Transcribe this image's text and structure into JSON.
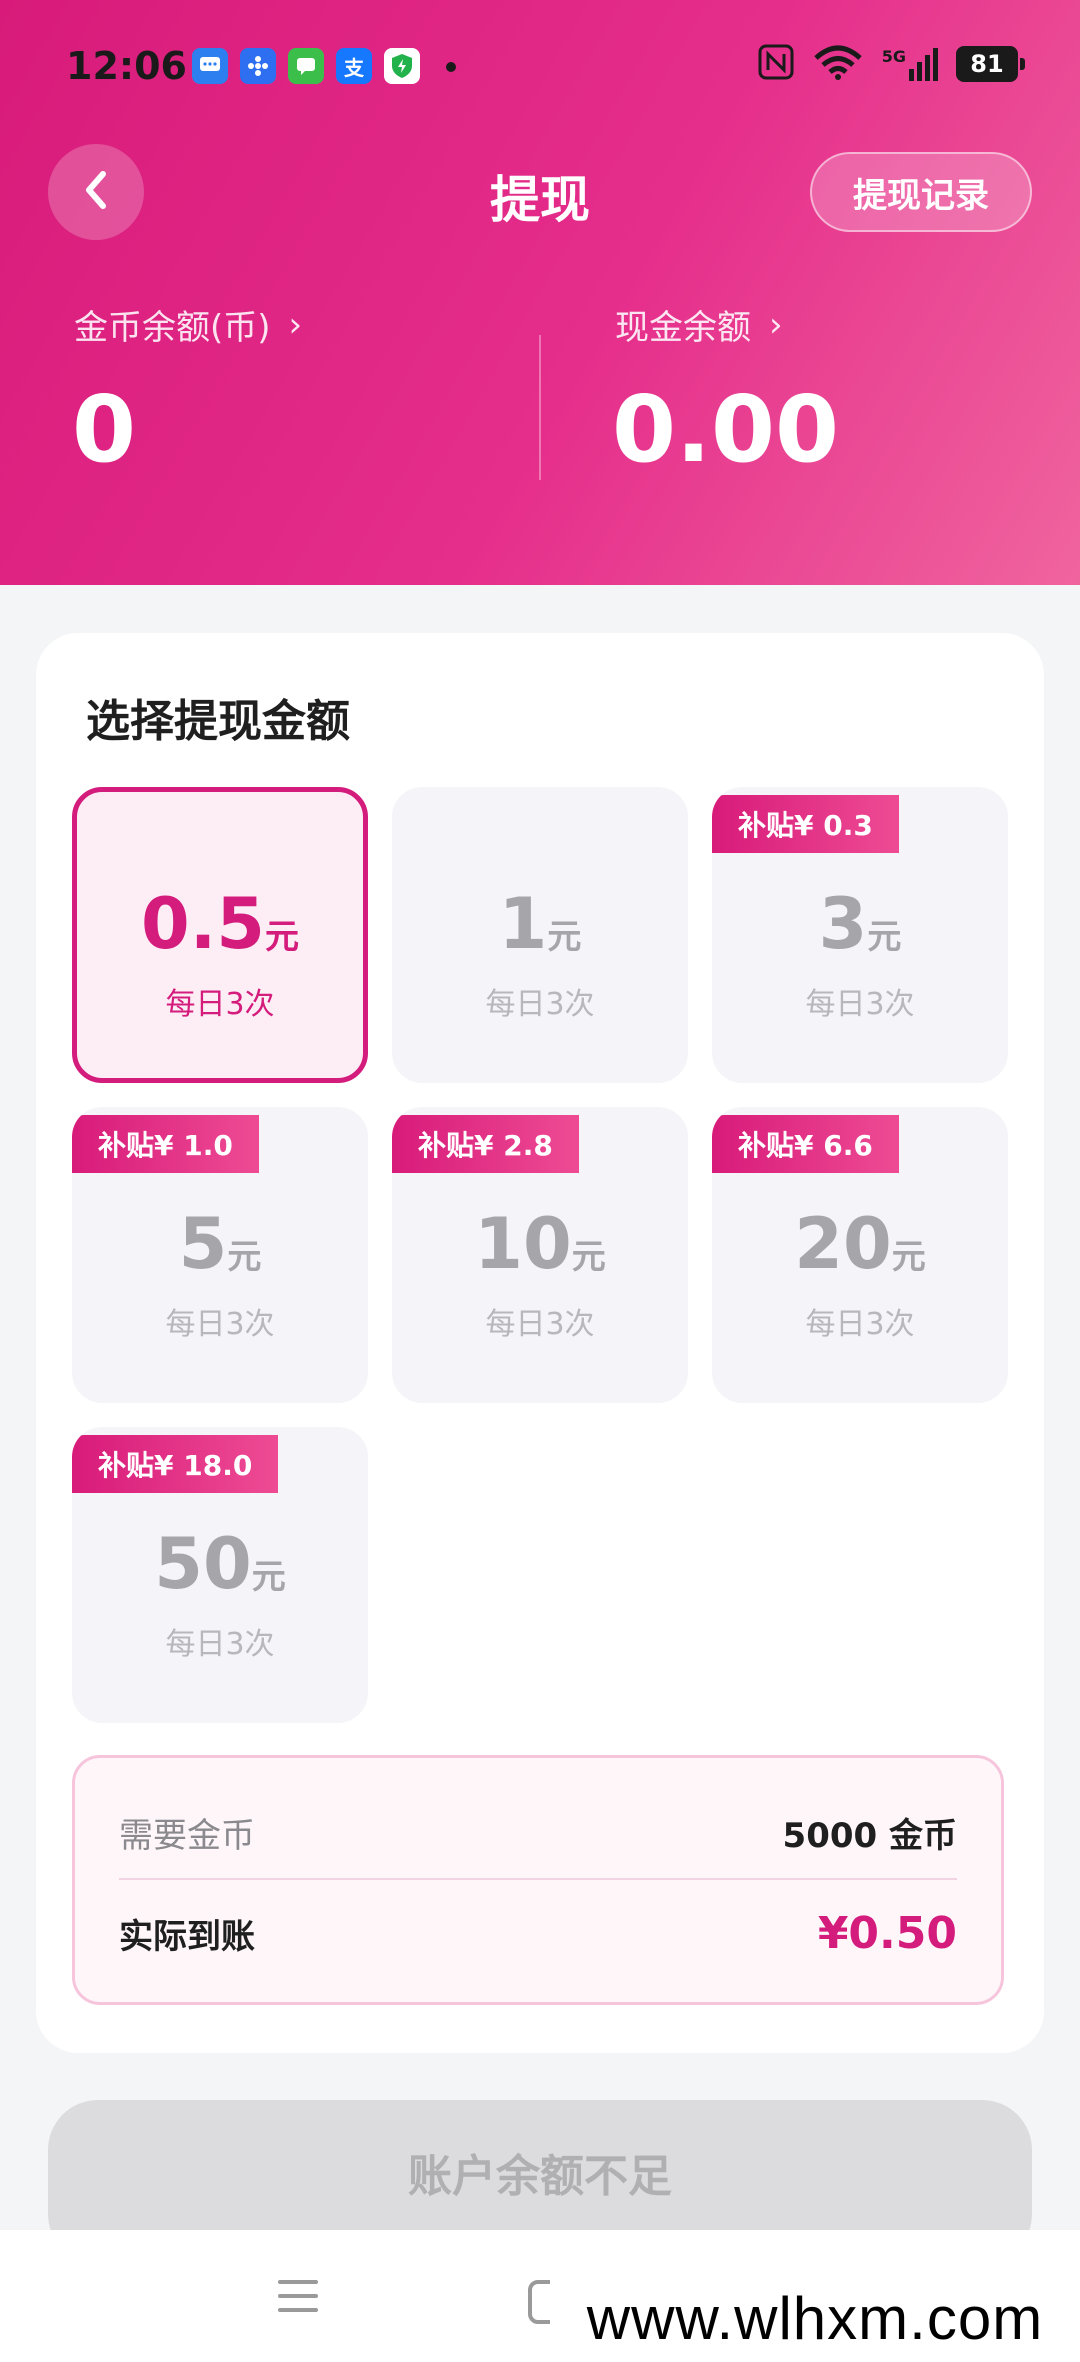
{
  "status_bar": {
    "time": "12:06",
    "battery": "81",
    "network": "5G",
    "notification_icons": [
      "message-icon",
      "pinwheel-icon",
      "chat-icon",
      "alipay-icon",
      "shield-icon"
    ],
    "alipay_glyph": "支"
  },
  "header": {
    "title": "提现",
    "record_button": "提现记录",
    "gold_balance_label": "金币余额(币)",
    "gold_balance_value": "0",
    "cash_balance_label": "现金余额",
    "cash_balance_value": "0.00",
    "arrow": "›"
  },
  "card": {
    "title": "选择提现金额",
    "options": [
      {
        "amount": "0.5",
        "unit": "元",
        "limit": "每日3次",
        "badge": ""
      },
      {
        "amount": "1",
        "unit": "元",
        "limit": "每日3次",
        "badge": ""
      },
      {
        "amount": "3",
        "unit": "元",
        "limit": "每日3次",
        "badge": "补贴¥ 0.3"
      },
      {
        "amount": "5",
        "unit": "元",
        "limit": "每日3次",
        "badge": "补贴¥ 1.0"
      },
      {
        "amount": "10",
        "unit": "元",
        "limit": "每日3次",
        "badge": "补贴¥ 2.8"
      },
      {
        "amount": "20",
        "unit": "元",
        "limit": "每日3次",
        "badge": "补贴¥ 6.6"
      },
      {
        "amount": "50",
        "unit": "元",
        "limit": "每日3次",
        "badge": "补贴¥ 18.0"
      }
    ],
    "summary": {
      "required_label": "需要金币",
      "required_value": "5000 金币",
      "actual_label": "实际到账",
      "actual_value": "¥0.50"
    }
  },
  "submit_button": "账户余额不足",
  "watermark": "www.wlhxm.com",
  "colors": {
    "brand": "#d41c7d",
    "header_gradient_start": "#d81b7a",
    "header_gradient_end": "#f0649e",
    "disabled": "#dcdcde"
  }
}
